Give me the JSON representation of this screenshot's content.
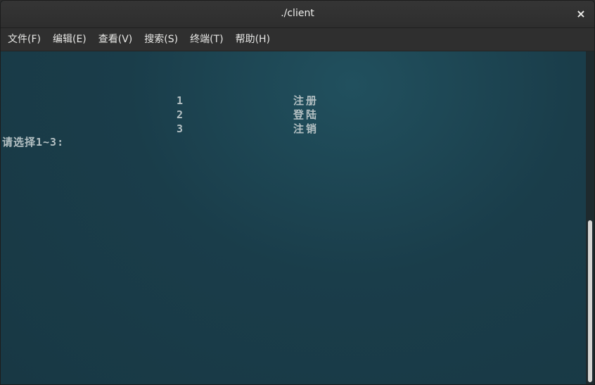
{
  "window": {
    "title": "./client",
    "close_label": "×"
  },
  "menubar": {
    "items": [
      {
        "label": "文件(F)"
      },
      {
        "label": "编辑(E)"
      },
      {
        "label": "查看(V)"
      },
      {
        "label": "搜索(S)"
      },
      {
        "label": "终端(T)"
      },
      {
        "label": "帮助(H)"
      }
    ]
  },
  "terminal": {
    "menu_options": [
      {
        "number": "1",
        "label": "注册"
      },
      {
        "number": "2",
        "label": "登陆"
      },
      {
        "number": "3",
        "label": "注销"
      }
    ],
    "prompt": "请选择1~3:"
  },
  "colors": {
    "terminal_bg": "#1c3f4c",
    "terminal_text": "#b4c0c3",
    "titlebar_bg": "#353535",
    "menubar_bg": "#2f2f2f"
  }
}
